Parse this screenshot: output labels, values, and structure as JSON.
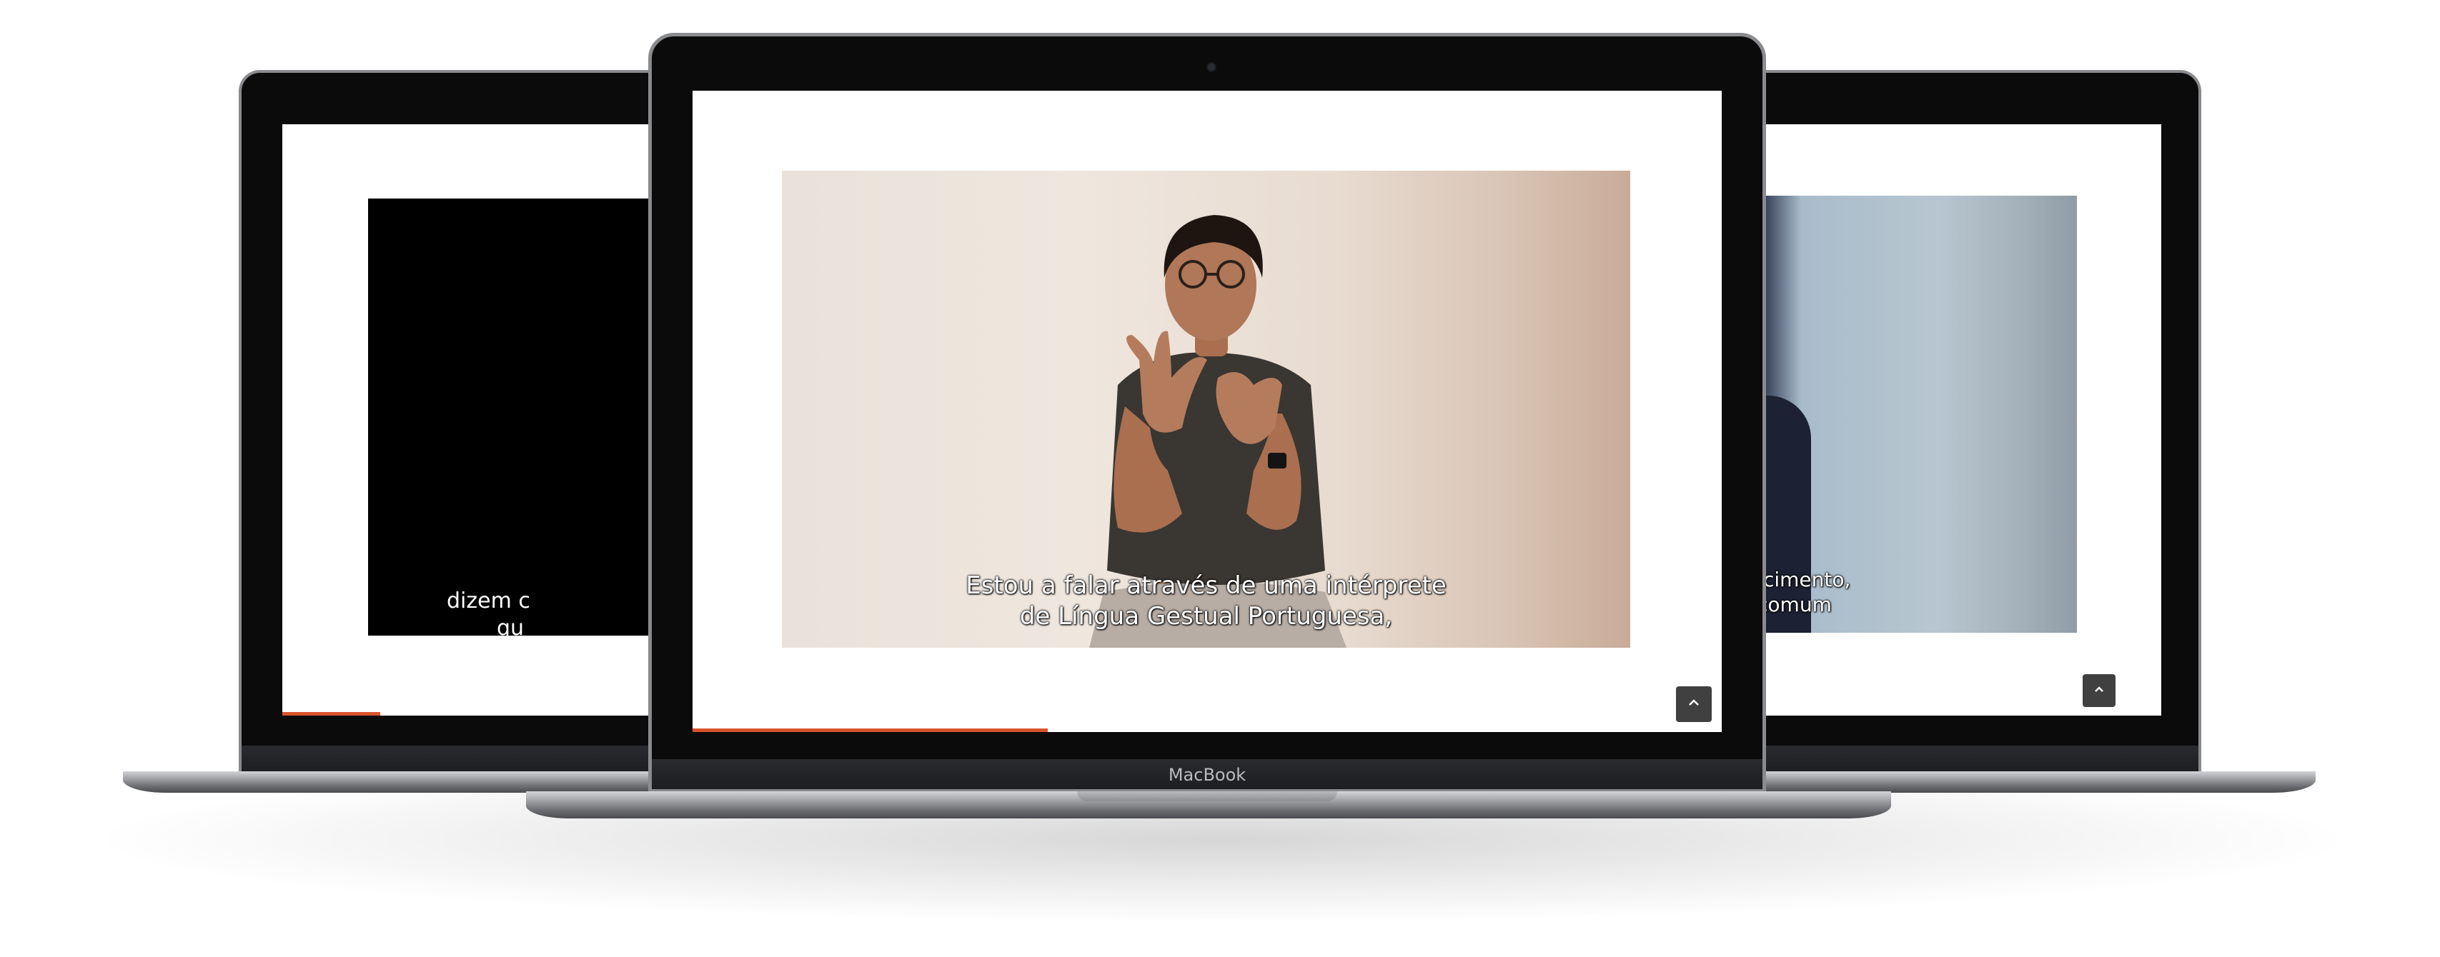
{
  "center_laptop": {
    "brand_label": "MacBook",
    "subtitle_line1": "Estou a falar através de uma intérprete",
    "subtitle_line2": "de Língua Gestual Portuguesa,",
    "progress_fraction": 0.34,
    "accent_color": "#d9542b"
  },
  "left_laptop": {
    "subtitle_line1": "dizem c",
    "subtitle_line2": "qu",
    "progress_fraction": 0.11
  },
  "right_laptop": {
    "subtitle_line1": "hecimento,",
    "subtitle_line2": "o comum"
  },
  "icons": {
    "scroll_top": "chevron-up-icon",
    "camera": "camera-dot-icon"
  }
}
